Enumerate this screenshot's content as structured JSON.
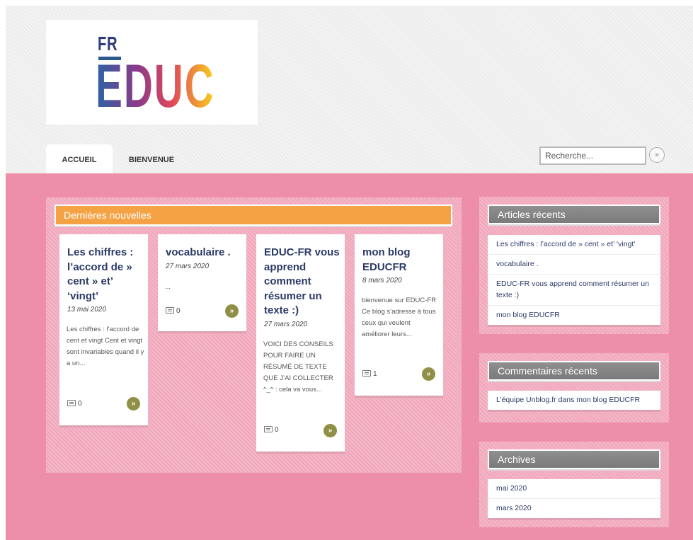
{
  "logo": {
    "line1": "FR",
    "line2": "EDUC"
  },
  "nav": {
    "tabs": [
      {
        "label": "ACCUEIL",
        "active": true
      },
      {
        "label": "BIENVENUE",
        "active": false
      }
    ]
  },
  "search": {
    "placeholder": "Recherche...",
    "button_glyph": "»"
  },
  "latest": {
    "title": "Dernières nouvelles",
    "posts": [
      {
        "title": "Les chiffres : l’accord de  » cent » et’ ‘vingt’",
        "date": "13 mai 2020",
        "excerpt": "Les chiffres : l’accord de cent et vingt Cent et vingt sont invariables quand il y a un...",
        "comments": "0"
      },
      {
        "title": "vocabulaire .",
        "date": "27 mars 2020",
        "excerpt": "...",
        "comments": "0"
      },
      {
        "title": "EDUC-FR vous apprend comment résumer un texte :)",
        "date": "27 mars 2020",
        "excerpt": "VOICI DES CONSEILS POUR FAIRE UN RÉSUMÉ DE TEXTE QUE J’AI COLLECTER ^_^ : cela va vous...",
        "comments": "0"
      },
      {
        "title": "mon blog EDUCFR",
        "date": "8 mars 2020",
        "excerpt": "bienvenue sur EDUC-FR Ce blog s’adresse à tous ceux qui veulent améliorer leurs...",
        "comments": "1"
      }
    ],
    "more_glyph": "»"
  },
  "sidebar": {
    "recent_articles": {
      "title": "Articles récents",
      "items": [
        "Les chiffres : l’accord de  » cent » et’ ‘vingt’",
        "vocabulaire .",
        "EDUC-FR vous apprend comment résumer un texte :)",
        "mon blog EDUCFR"
      ]
    },
    "recent_comments": {
      "title": "Commentaires récents",
      "items": [
        "L’équipe Unblog.fr dans mon blog EDUCFR"
      ]
    },
    "archives": {
      "title": "Archives",
      "items": [
        "mai 2020",
        "mars 2020"
      ]
    }
  },
  "colors": {
    "accent_orange": "#f4a244",
    "pink_background": "#ee8fa9",
    "title_blue": "#2b3a67",
    "more_button": "#8f8f45"
  }
}
